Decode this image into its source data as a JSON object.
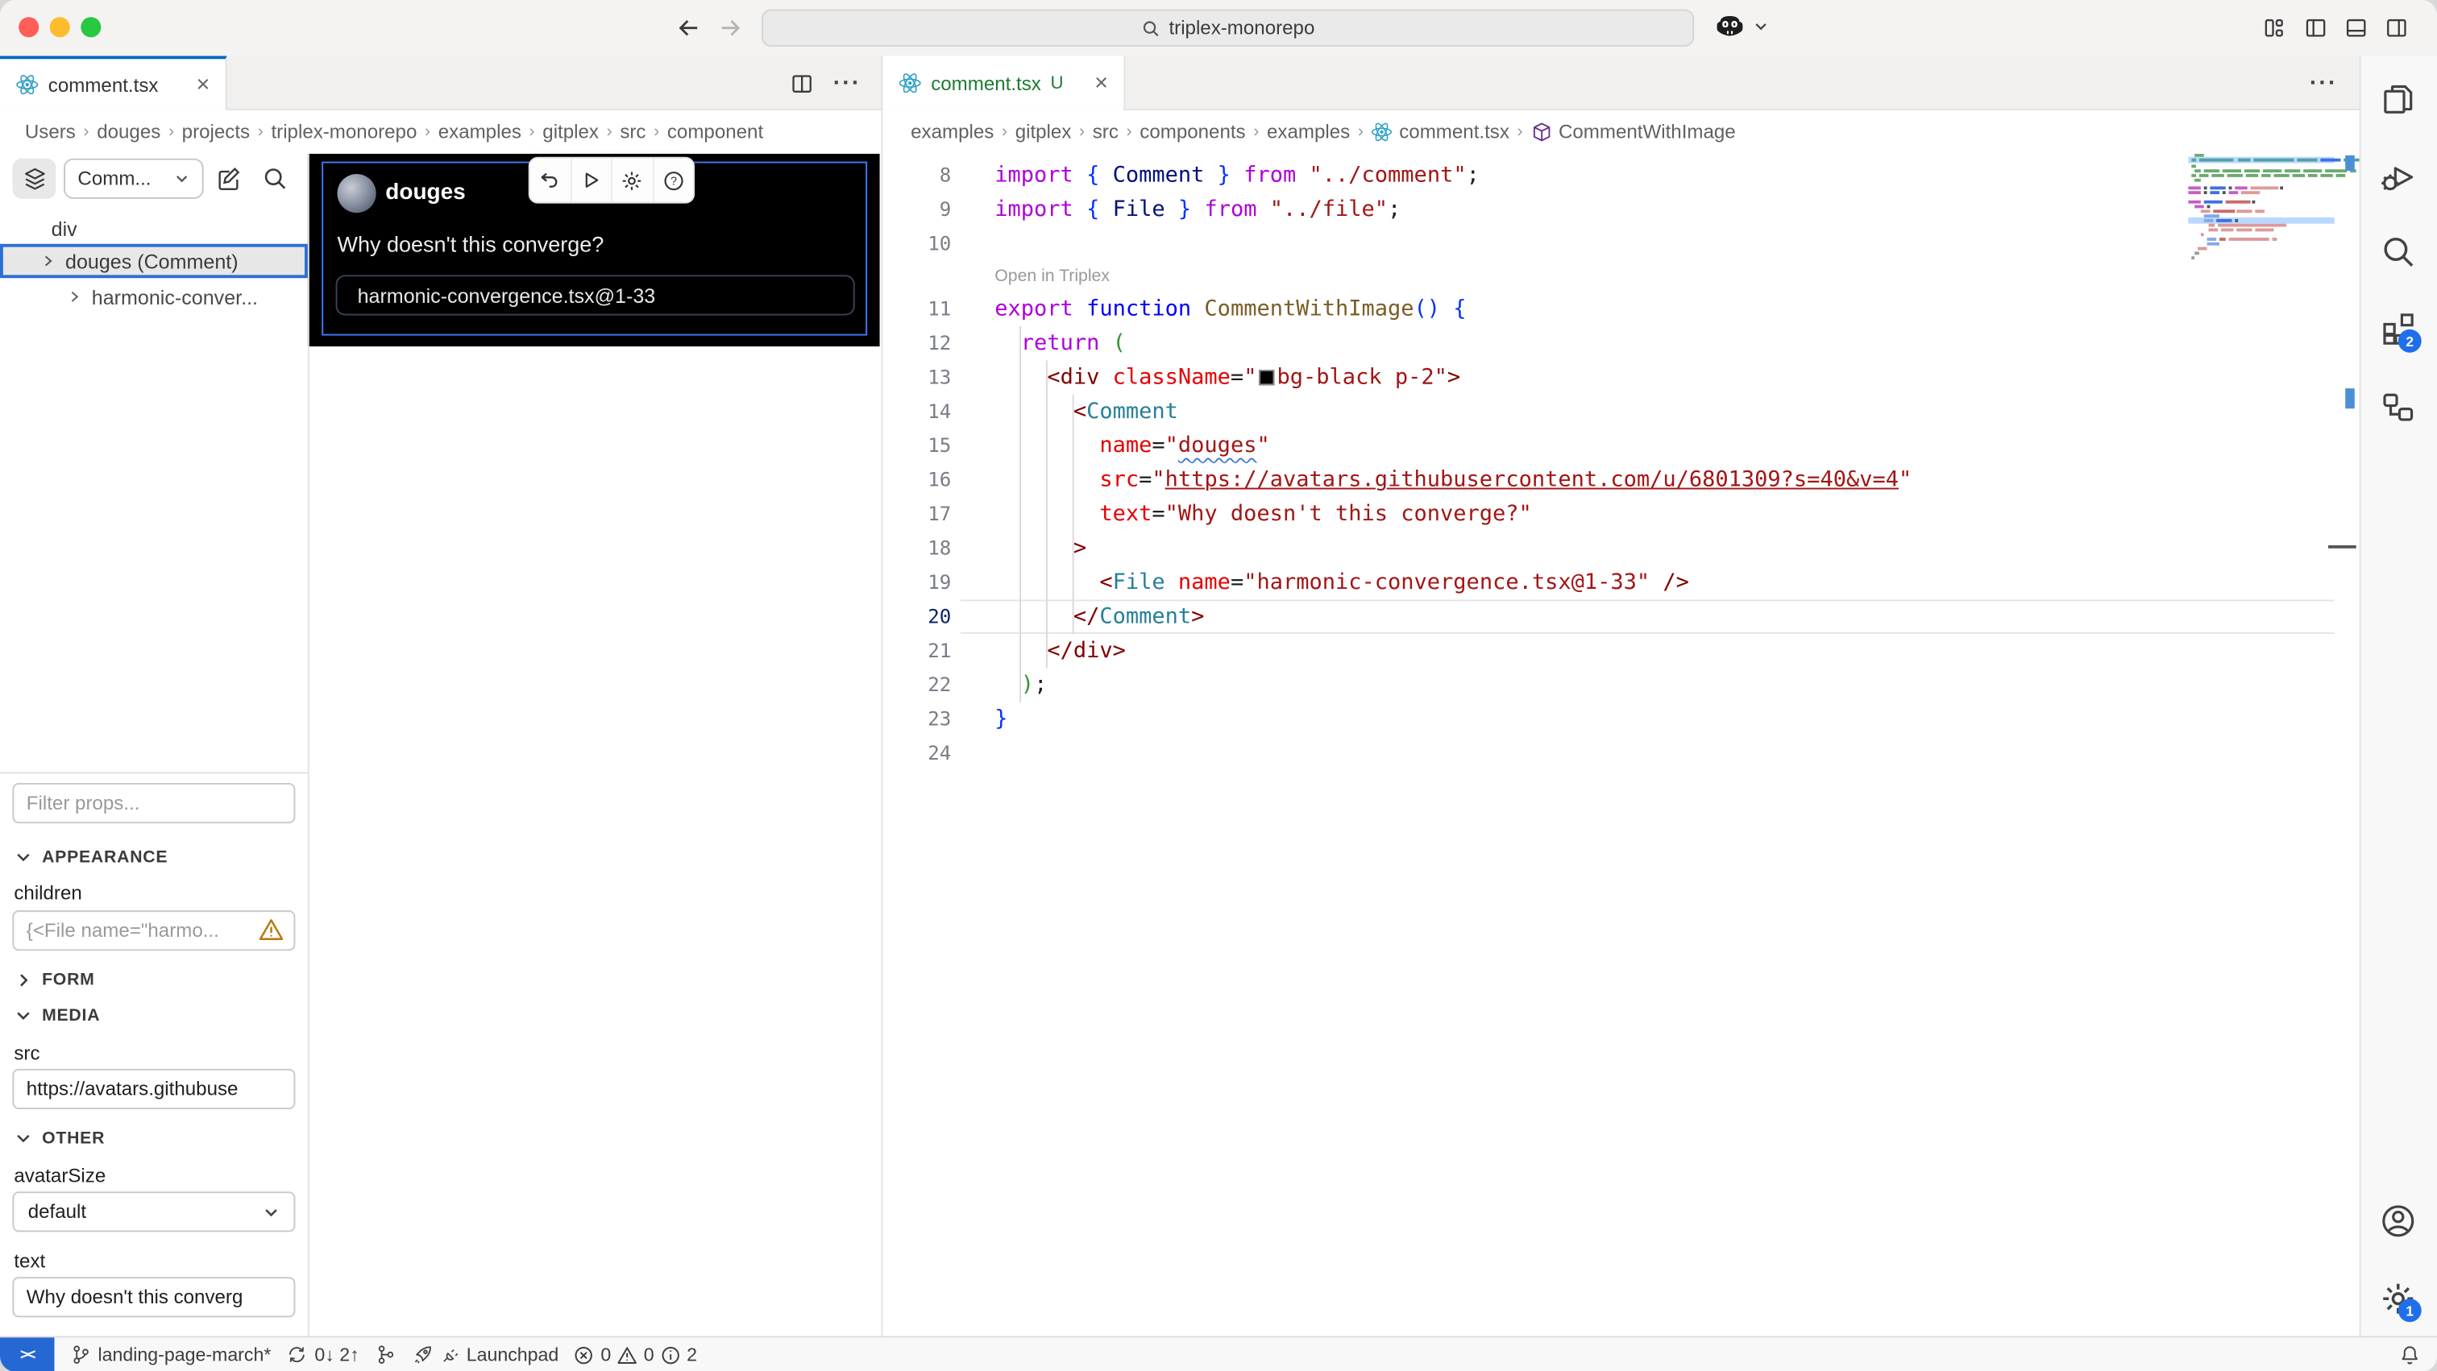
{
  "colors": {
    "accent_blue": "#0067c0",
    "selection_blue": "#3a7bfd",
    "untracked_green": "#1e7b34",
    "badge_blue": "#1f6feb",
    "warning_orange": "#b9770e",
    "canvas_black": "#000000"
  },
  "titlebar": {
    "command_center_value": "triplex-monorepo"
  },
  "left_editor": {
    "tab_label": "comment.tsx",
    "breadcrumb": [
      "Users",
      "douges",
      "projects",
      "triplex-monorepo",
      "examples",
      "gitplex",
      "src",
      "component"
    ],
    "triplex": {
      "component_select": "Comm...",
      "tree": [
        {
          "label": "div"
        },
        {
          "label": "douges (Comment)"
        },
        {
          "label": "harmonic-conver..."
        }
      ],
      "preview": {
        "author": "douges",
        "message": "Why doesn't this converge?",
        "file_chip": "harmonic-convergence.tsx@1-33"
      },
      "props": {
        "filter_placeholder": "Filter props...",
        "sections": {
          "appearance": "APPEARANCE",
          "form": "FORM",
          "media": "MEDIA",
          "other": "OTHER"
        },
        "children_label": "children",
        "children_placeholder": "{<File name=\"harmo...",
        "src_label": "src",
        "src_value": "https://avatars.githubuse",
        "avatar_size_label": "avatarSize",
        "avatar_size_value": "default",
        "text_label": "text",
        "text_value": "Why doesn't this converg"
      }
    }
  },
  "right_editor": {
    "tab_label": "comment.tsx",
    "tab_badge": "U",
    "breadcrumb": [
      {
        "label": "examples"
      },
      {
        "label": "gitplex"
      },
      {
        "label": "src"
      },
      {
        "label": "components"
      },
      {
        "label": "examples"
      },
      {
        "label": "comment.tsx",
        "icon": "react"
      },
      {
        "label": "CommentWithImage",
        "icon": "symbol"
      }
    ],
    "active_line": 20,
    "lines": [
      {
        "n": 8,
        "t": [
          [
            "kw",
            "import"
          ],
          [
            "pn",
            " "
          ],
          [
            "b1",
            "{"
          ],
          [
            "nv",
            " Comment "
          ],
          [
            "b1",
            "}"
          ],
          [
            "kw",
            " from"
          ],
          [
            "pn",
            " "
          ],
          [
            "st",
            "\"../comment\""
          ],
          [
            "pn",
            ";"
          ]
        ]
      },
      {
        "n": 9,
        "t": [
          [
            "kw",
            "import"
          ],
          [
            "pn",
            " "
          ],
          [
            "b1",
            "{"
          ],
          [
            "nv",
            " File "
          ],
          [
            "b1",
            "}"
          ],
          [
            "kw",
            " from"
          ],
          [
            "pn",
            " "
          ],
          [
            "st",
            "\"../file\""
          ],
          [
            "pn",
            ";"
          ]
        ]
      },
      {
        "n": 10,
        "t": []
      },
      {
        "n": 11,
        "lens": "Open in Triplex",
        "t": [
          [
            "kw",
            "export"
          ],
          [
            "pn",
            " "
          ],
          [
            "bl",
            "function"
          ],
          [
            "pn",
            " "
          ],
          [
            "fn",
            "CommentWithImage"
          ],
          [
            "b1",
            "()"
          ],
          [
            "pn",
            " "
          ],
          [
            "b1",
            "{"
          ]
        ]
      },
      {
        "n": 12,
        "t": [
          [
            "pn",
            "  "
          ],
          [
            "kw",
            "return"
          ],
          [
            "pn",
            " "
          ],
          [
            "b2",
            "("
          ]
        ]
      },
      {
        "n": 13,
        "t": [
          [
            "pn",
            "    "
          ],
          [
            "tg",
            "<div"
          ],
          [
            "pn",
            " "
          ],
          [
            "at",
            "className"
          ],
          [
            "pn",
            "="
          ],
          [
            "st",
            "\""
          ],
          [
            "sw",
            ""
          ],
          [
            "st",
            "bg-black p-2\""
          ],
          [
            "tg",
            ">"
          ]
        ]
      },
      {
        "n": 14,
        "t": [
          [
            "pn",
            "      "
          ],
          [
            "tg",
            "<"
          ],
          [
            "ty",
            "Comment"
          ]
        ]
      },
      {
        "n": 15,
        "t": [
          [
            "pn",
            "        "
          ],
          [
            "at",
            "name"
          ],
          [
            "pn",
            "="
          ],
          [
            "st",
            "\""
          ],
          [
            "sq",
            "douges"
          ],
          [
            "st",
            "\""
          ]
        ]
      },
      {
        "n": 16,
        "t": [
          [
            "pn",
            "        "
          ],
          [
            "at",
            "src"
          ],
          [
            "pn",
            "="
          ],
          [
            "st",
            "\""
          ],
          [
            "lk",
            "https://avatars.githubusercontent.com/u/6801309?s=40&v=4"
          ],
          [
            "st",
            "\""
          ]
        ]
      },
      {
        "n": 17,
        "t": [
          [
            "pn",
            "        "
          ],
          [
            "at",
            "text"
          ],
          [
            "pn",
            "="
          ],
          [
            "st",
            "\"Why doesn't this converge?\""
          ]
        ]
      },
      {
        "n": 18,
        "t": [
          [
            "pn",
            "      "
          ],
          [
            "tg",
            ">"
          ]
        ]
      },
      {
        "n": 19,
        "t": [
          [
            "pn",
            "        "
          ],
          [
            "tg",
            "<"
          ],
          [
            "ty",
            "File"
          ],
          [
            "pn",
            " "
          ],
          [
            "at",
            "name"
          ],
          [
            "pn",
            "="
          ],
          [
            "st",
            "\"harmonic-convergence.tsx@1-33\""
          ],
          [
            "pn",
            " "
          ],
          [
            "tg",
            "/>"
          ]
        ]
      },
      {
        "n": 20,
        "active": true,
        "t": [
          [
            "pn",
            "      "
          ],
          [
            "tg",
            "</"
          ],
          [
            "ty",
            "Comment"
          ],
          [
            "tg",
            ">"
          ]
        ]
      },
      {
        "n": 21,
        "t": [
          [
            "pn",
            "    "
          ],
          [
            "tg",
            "</div>"
          ]
        ]
      },
      {
        "n": 22,
        "t": [
          [
            "pn",
            "  "
          ],
          [
            "b2",
            ")"
          ],
          [
            "pn",
            ";"
          ]
        ]
      },
      {
        "n": 23,
        "t": [
          [
            "b1",
            "}"
          ]
        ]
      },
      {
        "n": 24,
        "t": []
      }
    ],
    "minimap_rows": [
      {
        "y": 0,
        "bars": [
          [
            4,
            6,
            "g"
          ]
        ]
      },
      {
        "y": 3,
        "hl": true,
        "bars": [
          [
            2,
            3,
            "t"
          ],
          [
            7,
            22,
            "t"
          ],
          [
            32,
            8,
            "t"
          ],
          [
            42,
            26,
            "t"
          ],
          [
            70,
            13,
            "t"
          ],
          [
            85,
            13,
            "B"
          ],
          [
            100,
            5,
            "t"
          ],
          [
            107,
            12,
            "t"
          ],
          [
            121,
            14,
            "t"
          ]
        ]
      },
      {
        "y": 7,
        "bars": [
          [
            2,
            3,
            "g"
          ]
        ]
      },
      {
        "y": 10,
        "bars": [
          [
            4,
            4,
            "g"
          ],
          [
            10,
            10,
            "g"
          ],
          [
            22,
            12,
            "g"
          ],
          [
            36,
            10,
            "g"
          ],
          [
            48,
            12,
            "g"
          ],
          [
            62,
            10,
            "g"
          ],
          [
            74,
            12,
            "g"
          ],
          [
            88,
            14,
            "g"
          ],
          [
            104,
            4,
            "g"
          ]
        ]
      },
      {
        "y": 13,
        "bars": [
          [
            2,
            3,
            "g"
          ],
          [
            7,
            6,
            "g"
          ],
          [
            15,
            8,
            "g"
          ],
          [
            25,
            10,
            "g"
          ],
          [
            37,
            8,
            "g"
          ],
          [
            47,
            6,
            "g"
          ],
          [
            55,
            10,
            "g"
          ],
          [
            67,
            8,
            "g"
          ],
          [
            77,
            6,
            "g"
          ],
          [
            85,
            8,
            "g"
          ],
          [
            95,
            6,
            "g"
          ]
        ]
      },
      {
        "y": 16,
        "bars": [
          [
            4,
            4,
            "g"
          ]
        ]
      },
      {
        "y": 21,
        "bars": [
          [
            0,
            8,
            "m"
          ],
          [
            10,
            2,
            "p"
          ],
          [
            14,
            10,
            "B"
          ],
          [
            26,
            2,
            "p"
          ],
          [
            30,
            8,
            "m"
          ],
          [
            40,
            18,
            "r"
          ],
          [
            59,
            2,
            "p"
          ]
        ]
      },
      {
        "y": 24,
        "bars": [
          [
            0,
            8,
            "m"
          ],
          [
            10,
            2,
            "p"
          ],
          [
            14,
            6,
            "B"
          ],
          [
            22,
            2,
            "p"
          ],
          [
            26,
            6,
            "m"
          ],
          [
            34,
            12,
            "r"
          ]
        ]
      },
      {
        "y": 30,
        "bars": [
          [
            0,
            8,
            "m"
          ],
          [
            10,
            12,
            "B"
          ],
          [
            24,
            16,
            "R"
          ],
          [
            41,
            2,
            "p"
          ]
        ]
      },
      {
        "y": 33,
        "bars": [
          [
            4,
            6,
            "m"
          ],
          [
            12,
            2,
            "p"
          ]
        ]
      },
      {
        "y": 36,
        "bars": [
          [
            8,
            6,
            "r"
          ],
          [
            16,
            14,
            "R"
          ],
          [
            31,
            10,
            "r"
          ],
          [
            43,
            6,
            "r"
          ]
        ]
      },
      {
        "y": 39,
        "bars": [
          [
            10,
            10,
            "b"
          ]
        ]
      },
      {
        "y": 42,
        "hl": true,
        "bars": [
          [
            10,
            6,
            "b"
          ],
          [
            18,
            10,
            "B"
          ],
          [
            30,
            2,
            "p"
          ]
        ]
      },
      {
        "y": 45,
        "bars": [
          [
            13,
            4,
            "r"
          ],
          [
            19,
            44,
            "r"
          ]
        ]
      },
      {
        "y": 48,
        "bars": [
          [
            13,
            6,
            "r"
          ],
          [
            21,
            8,
            "r"
          ],
          [
            31,
            10,
            "r"
          ],
          [
            43,
            12,
            "r"
          ]
        ]
      },
      {
        "y": 51,
        "bars": [
          [
            8,
            2,
            "r"
          ]
        ]
      },
      {
        "y": 54,
        "bars": [
          [
            12,
            6,
            "b"
          ],
          [
            20,
            4,
            "R"
          ],
          [
            26,
            26,
            "r"
          ],
          [
            54,
            3,
            "r"
          ]
        ]
      },
      {
        "y": 57,
        "bars": [
          [
            12,
            8,
            "b"
          ]
        ]
      },
      {
        "y": 60,
        "bars": [
          [
            6,
            6,
            "r"
          ]
        ]
      },
      {
        "y": 63,
        "bars": [
          [
            4,
            3,
            "G"
          ]
        ]
      },
      {
        "y": 66,
        "bars": [
          [
            2,
            2,
            "G"
          ]
        ]
      }
    ]
  },
  "activity_bar": {
    "extensions_badge": "2",
    "settings_badge": "1"
  },
  "status_bar": {
    "branch": "landing-page-march*",
    "sync": "0↓ 2↑",
    "launchpad": "Launchpad",
    "errors": "0",
    "warnings": "0",
    "infos": "2"
  }
}
